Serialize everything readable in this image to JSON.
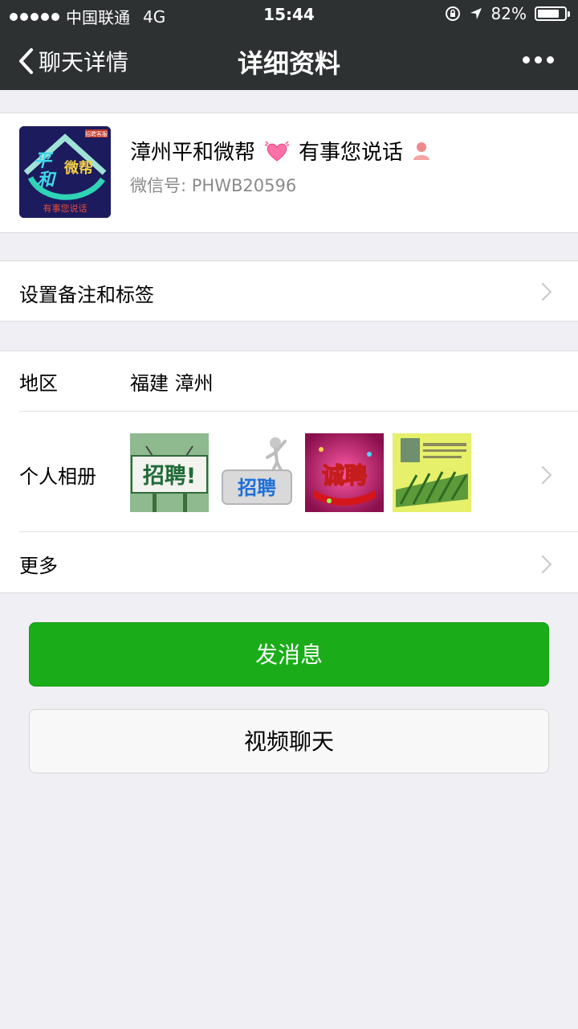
{
  "status_bar": {
    "carrier": "中国联通",
    "network": "4G",
    "time": "15:44",
    "battery": "82%",
    "battery_level": 0.82
  },
  "nav": {
    "back_label": "聊天详情",
    "title": "详细资料"
  },
  "profile": {
    "name": "漳州平和微帮",
    "signature": "有事您说话",
    "wechat_id_label": "微信号:",
    "wechat_id": "PHWB20596",
    "avatar_text": {
      "big1": "平",
      "big2": "和",
      "small": "微帮",
      "badge": "招聘客服",
      "bottom": "有事您说话"
    }
  },
  "remark": {
    "label": "设置备注和标签"
  },
  "region": {
    "label": "地区",
    "value": "福建 漳州"
  },
  "album": {
    "label": "个人相册",
    "thumbs": [
      "招聘!",
      "招聘",
      "诚聘",
      ""
    ]
  },
  "more": {
    "label": "更多"
  },
  "buttons": {
    "send_message": "发消息",
    "video_call": "视频聊天"
  },
  "colors": {
    "nav_bg": "#2e3132",
    "green": "#1aad19",
    "page_bg": "#efeff4"
  }
}
